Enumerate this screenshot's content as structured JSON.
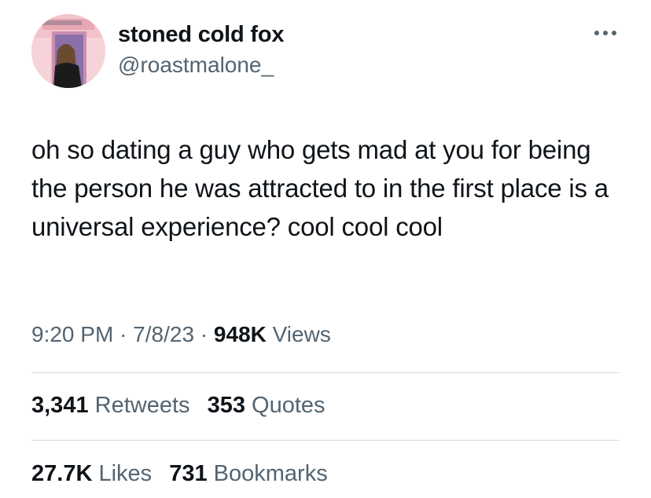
{
  "author": {
    "display_name": "stoned cold fox",
    "handle": "@roastmalone_"
  },
  "icons": {
    "more": "more-options-icon",
    "avatar": "profile-photo"
  },
  "tweet": {
    "text": "oh so dating a guy who gets mad at you for being the person he was attracted to in the first place is a universal experience? cool cool cool"
  },
  "meta": {
    "time": "9:20 PM",
    "date": "7/8/23",
    "separator": "·",
    "views_count": "948K",
    "views_label": "Views"
  },
  "stats": {
    "retweets_count": "3,341",
    "retweets_label": "Retweets",
    "quotes_count": "353",
    "quotes_label": "Quotes",
    "likes_count": "27.7K",
    "likes_label": "Likes",
    "bookmarks_count": "731",
    "bookmarks_label": "Bookmarks"
  },
  "colors": {
    "text": "#0f1419",
    "secondary": "#536471",
    "divider": "#cfd9de"
  }
}
